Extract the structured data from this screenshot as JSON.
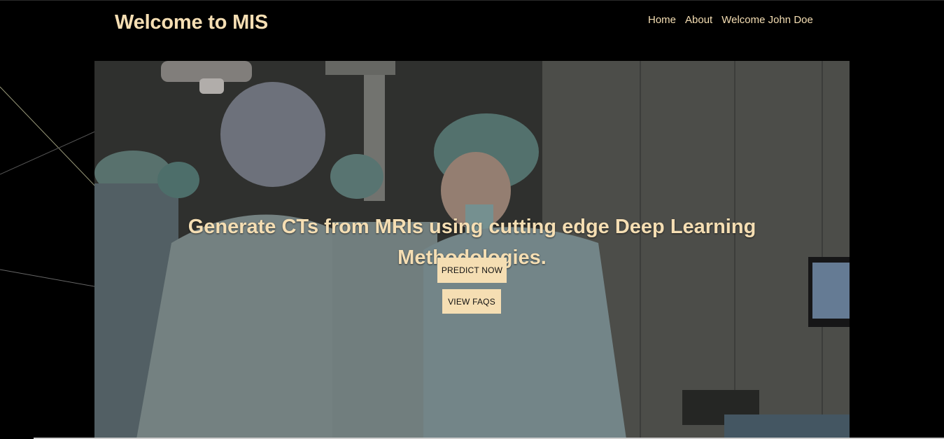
{
  "header": {
    "brand": "Welcome to MIS",
    "nav": [
      {
        "label": "Home"
      },
      {
        "label": "About"
      },
      {
        "label": "Welcome John Doe"
      }
    ]
  },
  "hero": {
    "headline": "Generate CTs from MRIs using cutting edge Deep Learning Methodologies.",
    "buttons": {
      "predict": "PREDICT NOW",
      "faqs": "VIEW FAQS"
    },
    "background_image": "surgeons-operating-room-photo"
  },
  "colors": {
    "accent": "#f5deb3",
    "background": "#000000"
  }
}
